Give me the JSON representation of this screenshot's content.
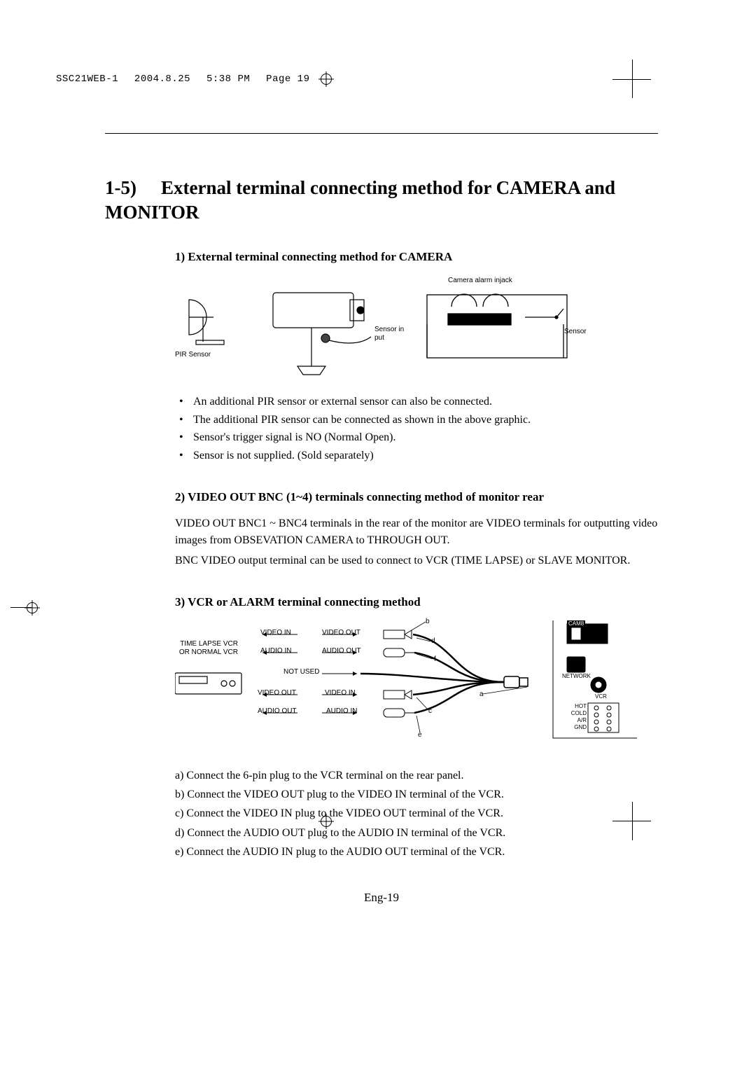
{
  "meta": {
    "doc_id": "SSC21WEB-1",
    "date": "2004.8.25",
    "time": "5:38 PM",
    "page_label": "Page 19"
  },
  "section": {
    "number": "1-5)",
    "title": "External terminal connecting method for CAMERA and MONITOR"
  },
  "sub1": {
    "heading": "1) External terminal connecting method for CAMERA",
    "labels": {
      "pir": "PIR Sensor",
      "sensor_input": "Sensor in put",
      "alarm_jack": "Camera alarm injack",
      "sensor": "Sensor"
    },
    "bullets": [
      "An additional PIR sensor or external sensor can also be connected.",
      "The additional PIR sensor can be connected as shown in the above graphic.",
      "Sensor's trigger signal is NO (Normal Open).",
      "Sensor is not supplied. (Sold separately)"
    ]
  },
  "sub2": {
    "heading": "2) VIDEO OUT BNC (1~4) terminals connecting method of monitor rear",
    "para1": "VIDEO OUT BNC1 ~ BNC4 terminals in the rear of the monitor are VIDEO terminals for outputting video images from OBSEVATION CAMERA to THROUGH OUT.",
    "para2": "BNC VIDEO output terminal can be used to connect to VCR (TIME LAPSE) or SLAVE MONITOR."
  },
  "sub3": {
    "heading": "3) VCR or ALARM terminal connecting method",
    "vcr_caption_line1": "TIME LAPSE VCR",
    "vcr_caption_line2": "OR NORMAL VCR",
    "arrows": {
      "video_in": "VIDEO IN",
      "video_out": "VIDEO OUT",
      "audio_in": "AUDIO IN",
      "audio_out": "AUDIO OUT",
      "not_used": "NOT USED"
    },
    "callouts": {
      "a": "a",
      "b": "b",
      "c": "c",
      "d": "d",
      "e": "e",
      "f": "f"
    },
    "panel": {
      "cam8": "CAM8",
      "network": "NETWORK",
      "vcr": "VCR",
      "hot": "HOT",
      "cold": "COLD",
      "ar": "A/R",
      "gnd": "GND"
    },
    "steps": [
      "a) Connect the 6-pin plug to the VCR terminal on the rear panel.",
      "b) Connect the VIDEO OUT plug to the VIDEO IN terminal of the VCR.",
      "c) Connect the VIDEO IN plug to the VIDEO OUT terminal of the VCR.",
      "d) Connect the AUDIO OUT plug to the AUDIO IN terminal of the VCR.",
      "e) Connect the AUDIO IN plug to the AUDIO OUT terminal of the VCR."
    ]
  },
  "footer": "Eng-19"
}
